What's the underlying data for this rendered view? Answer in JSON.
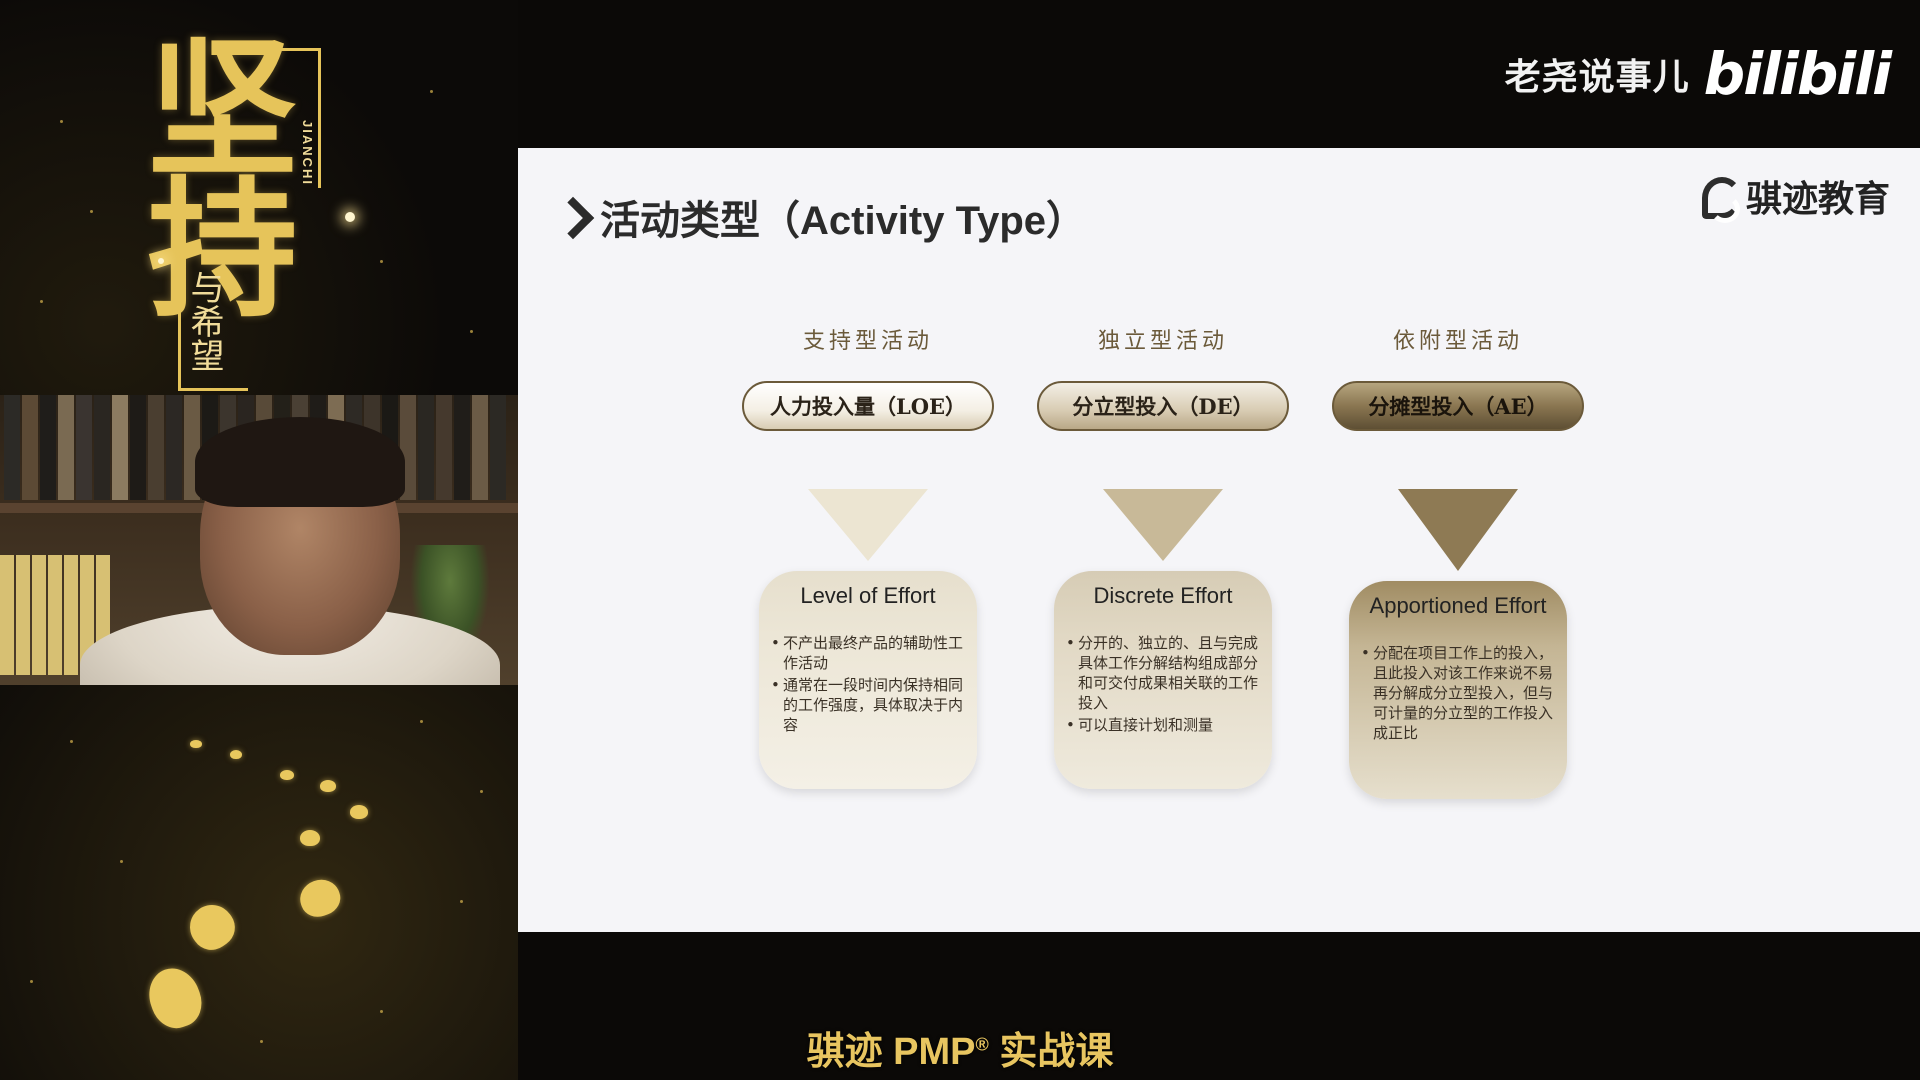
{
  "brand": {
    "name": "老尧说事儿",
    "logo_text": "bilibili"
  },
  "poster": {
    "main_text": "坚持",
    "sub_text": "与希望",
    "pinyin": "JIANCHI"
  },
  "slide": {
    "title": "活动类型（Activity Type）",
    "company": "骐迹教育",
    "columns": [
      {
        "heading": "支持型活动",
        "pill": "人力投入量（LOE）",
        "card_title": "Level of Effort",
        "bullets": [
          "不产出最终产品的辅助性工作活动",
          "通常在一段时间内保持相同的工作强度，具体取决于内容"
        ]
      },
      {
        "heading": "独立型活动",
        "pill": "分立型投入（DE）",
        "card_title": "Discrete Effort",
        "bullets": [
          "分开的、独立的、且与完成具体工作分解结构组成部分和可交付成果相关联的工作投入",
          "可以直接计划和测量"
        ]
      },
      {
        "heading": "依附型活动",
        "pill": "分摊型投入（AE）",
        "card_title": "Apportioned Effort",
        "bullets": [
          "分配在项目工作上的投入，且此投入对该工作来说不易再分解成分立型投入，但与可计量的分立型的工作投入成正比"
        ]
      }
    ]
  },
  "caption": {
    "prefix": "骐迹 PMP",
    "reg": "®",
    "suffix": " 实战课"
  },
  "colors": {
    "gold": "#e6c45a",
    "slide_bg": "#f5f5f8",
    "dark_bg": "#0b0907"
  }
}
